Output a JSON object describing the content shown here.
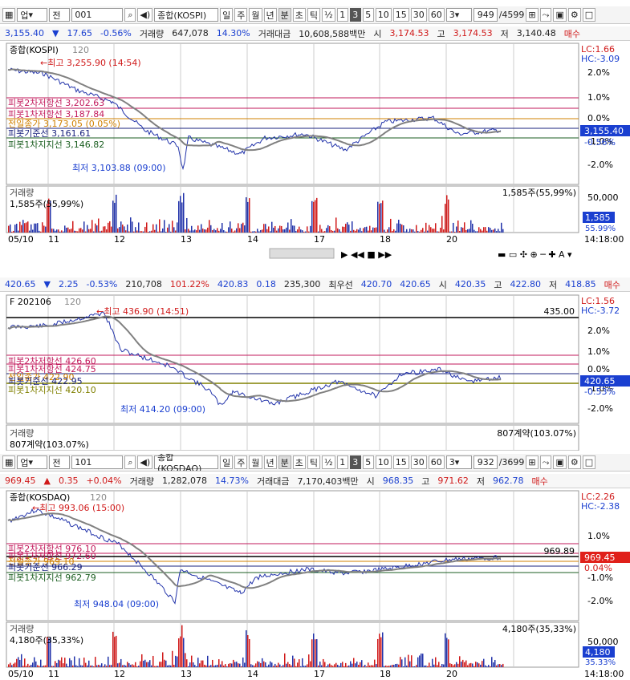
{
  "panel1": {
    "toolbar": {
      "market": "업",
      "sel_label": "전",
      "code": "001",
      "name": "종합(KOSPI)",
      "periods": [
        "일",
        "주",
        "월",
        "년",
        "분",
        "초",
        "틱",
        "½",
        "1",
        "3",
        "5",
        "10",
        "15",
        "30",
        "60"
      ],
      "active_period": "3",
      "interval": "3",
      "count": "949",
      "total": "/4599"
    },
    "quote": {
      "price": "3,155.40",
      "arrow": "▼",
      "change": "17.65",
      "pct": "-0.56%",
      "vol_label": "거래량",
      "vol": "647,078",
      "vol_pct": "14.30%",
      "amt_label": "거래대금",
      "amt": "10,608,588백만",
      "open_label": "시",
      "open": "3,174.53",
      "high_label": "고",
      "high": "3,174.53",
      "low_label": "저",
      "low": "3,140.48",
      "buy": "매수"
    },
    "chart": {
      "title": "종합(KOSPI)",
      "period": "120",
      "high_note": "←최고 3,255.90 (14:54)",
      "low_note": "최저 3,103.88 (09:00)",
      "lc": "LC:1.66",
      "hc": "HC:-3.09",
      "price_tag": "3,155.40",
      "pct_tag": "-0.56%",
      "lines": [
        "피봇2차저항선 3,202.63",
        "피봇1차저항선 3,187.84",
        "전일종가 3,173.05 (0.05%)",
        "피봇기준선 3,161.61",
        "피봇1차지지선 3,146.82"
      ],
      "y_pcts": [
        "2.0%",
        "1.0%",
        "0.0%",
        "-1.0%",
        "-2.0%"
      ],
      "vol_title": "거래량",
      "vol_left": "1,585주(55,99%)",
      "vol_right": "1,585주(55,99%)",
      "vol_scale": "50,000",
      "vol_tag": "1,585",
      "vol_pct_tag": "55.99%"
    },
    "dates": [
      "05/10",
      "11",
      "12",
      "13",
      "14",
      "17",
      "18",
      "20"
    ],
    "time": "14:18:00"
  },
  "panel2": {
    "quote": {
      "price": "420.65",
      "arrow": "▼",
      "change": "2.25",
      "pct": "-0.53%",
      "vol": "210,708",
      "vol_pct": "101.22%",
      "v1": "420.83",
      "v2": "0.18",
      "v3": "235,300",
      "best_label": "최우선",
      "v4": "420.70",
      "v5": "420.65",
      "ask_label": "시",
      "v6": "420.35",
      "high_label": "고",
      "high": "422.80",
      "low_label": "저",
      "low": "418.85",
      "buy": "매수"
    },
    "chart": {
      "title": "F 202106",
      "period": "120",
      "high_note": "←최고 436.90 (14:51)",
      "low_note": "최저 414.20 (09:00)",
      "lc": "LC:1.56",
      "hc": "HC:-3.72",
      "level": "435.00",
      "price_tag": "420.65",
      "pct_tag": "-0.53%",
      "lines": [
        "피봇2차저항선 426.60",
        "피봇1차저항선 424.75",
        "전일종가 422.90",
        "피봇기준선 422.95",
        "피봇1차지지선 420.10"
      ],
      "y_pcts": [
        "2.0%",
        "1.0%",
        "0.0%",
        "-1.0%",
        "-2.0%"
      ],
      "vol_title": "거래량",
      "vol_left": "807계약(103.07%)",
      "vol_right": "807계약(103.07%)"
    }
  },
  "panel3": {
    "toolbar": {
      "market": "업",
      "sel_label": "전",
      "code": "101",
      "name": "종합(KOSDAQ)",
      "periods": [
        "일",
        "주",
        "월",
        "년",
        "분",
        "초",
        "틱",
        "½",
        "1",
        "3",
        "5",
        "10",
        "15",
        "30",
        "60"
      ],
      "active_period": "3",
      "interval": "3",
      "count": "932",
      "total": "/3699"
    },
    "quote": {
      "price": "969.45",
      "arrow": "▲",
      "change": "0.35",
      "pct": "+0.04%",
      "vol_label": "거래량",
      "vol": "1,282,078",
      "vol_pct": "14.73%",
      "amt_label": "거래대금",
      "amt": "7,170,403백만",
      "open_label": "시",
      "open": "968.35",
      "high_label": "고",
      "high": "971.62",
      "low_label": "저",
      "low": "962.78",
      "buy": "매수"
    },
    "chart": {
      "title": "종합(KOSDAQ)",
      "period": "120",
      "high_note": "←최고 993.06 (15:00)",
      "low_note": "최저 948.04 (09:00)",
      "lc": "LC:2.26",
      "hc": "HC:-2.38",
      "level": "969.89",
      "price_tag": "969.45",
      "pct_tag": "0.04%",
      "lines": [
        "피봇2차저항선 976.10",
        "피봇1차저항선 972.60",
        "전일종가 969.10",
        "피봇기준선 966.29",
        "피봇1차지지선 962.79"
      ],
      "y_pcts": [
        "1.0%",
        "0.0%",
        "-1.0%",
        "-2.0%"
      ],
      "vol_title": "거래량",
      "vol_left": "4,180주(35,33%)",
      "vol_right": "4,180주(35,33%)",
      "vol_scale": "50,000",
      "vol_tag": "4,180",
      "vol_pct_tag": "35.33%"
    },
    "dates": [
      "05/10",
      "11",
      "12",
      "13",
      "14",
      "17",
      "18",
      "20"
    ],
    "time": "14:18:00"
  }
}
